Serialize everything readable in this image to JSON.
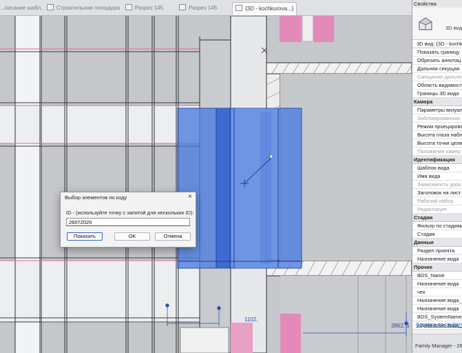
{
  "tabs": [
    {
      "label": "...писание шабл...",
      "active": false
    },
    {
      "label": "Строительная площадка",
      "active": false
    },
    {
      "label": "Разрез 145",
      "active": false
    },
    {
      "label": "Разрез 146",
      "active": false
    },
    {
      "label": "{3D - kochkurova...}",
      "active": true
    }
  ],
  "tab_close_glyph": "×",
  "properties": {
    "title": "Свойства",
    "type_label": "3D вид",
    "view_selector": "3D вид: {3D - kochk",
    "rows": [
      {
        "label": "Показать границу",
        "kind": "row"
      },
      {
        "label": "Обрезать аннотац",
        "kind": "row"
      },
      {
        "label": "Дальняя секущая",
        "kind": "row"
      },
      {
        "label": "Смещение дальне",
        "kind": "disabled"
      },
      {
        "label": "Область видимост",
        "kind": "row"
      },
      {
        "label": "Границы 3D вида",
        "kind": "row"
      },
      {
        "label": "Камера",
        "kind": "group"
      },
      {
        "label": "Параметры визуал",
        "kind": "row"
      },
      {
        "label": "Заблокированная",
        "kind": "disabled"
      },
      {
        "label": "Режим проецирова",
        "kind": "row"
      },
      {
        "label": "Высота глаза набл",
        "kind": "row"
      },
      {
        "label": "Высота точки цели",
        "kind": "row"
      },
      {
        "label": "Положение камер",
        "kind": "disabled"
      },
      {
        "label": "Идентификация",
        "kind": "group"
      },
      {
        "label": "Шаблон вида",
        "kind": "row"
      },
      {
        "label": "Имя вида",
        "kind": "row"
      },
      {
        "label": "Зависимость уров",
        "kind": "disabled"
      },
      {
        "label": "Заголовок на лист",
        "kind": "row"
      },
      {
        "label": "Рабочий набор",
        "kind": "disabled"
      },
      {
        "label": "Редактирует",
        "kind": "disabled"
      },
      {
        "label": "Стадии",
        "kind": "group"
      },
      {
        "label": "Фильтр по стадиям",
        "kind": "row"
      },
      {
        "label": "Стадия",
        "kind": "row"
      },
      {
        "label": "Данные",
        "kind": "group"
      },
      {
        "label": "Раздел проекта",
        "kind": "row"
      },
      {
        "label": "Назначение вида",
        "kind": "row"
      },
      {
        "label": "Прочее",
        "kind": "group"
      },
      {
        "label": "BDS_Name",
        "kind": "row"
      },
      {
        "label": "Назначение вида",
        "kind": "row"
      },
      {
        "label": "чек",
        "kind": "row"
      },
      {
        "label": "Назначение вида_1",
        "kind": "row"
      },
      {
        "label": "Назначение вида",
        "kind": "row"
      },
      {
        "label": "BDS_SystemName",
        "kind": "row"
      },
      {
        "label": "Назначение вида_2",
        "kind": "row"
      }
    ],
    "help_link": "Справка по свойств",
    "status": "Family Manager - 26"
  },
  "dialog": {
    "title": "Выбор элементов по коду",
    "close_glyph": "×",
    "label": "ID - (используйте точку с запятой для нескольких ID):",
    "input_value": "26072020",
    "show_button": "Показать",
    "ok_button": "OK",
    "cancel_button": "Отмена"
  },
  "dimensions": {
    "left": "1102,",
    "right": "3862, 5"
  },
  "colors": {
    "selection_blue": "#3f6fd6",
    "accent_pink": "#e48ab8",
    "link_blue": "#2a62c9"
  }
}
